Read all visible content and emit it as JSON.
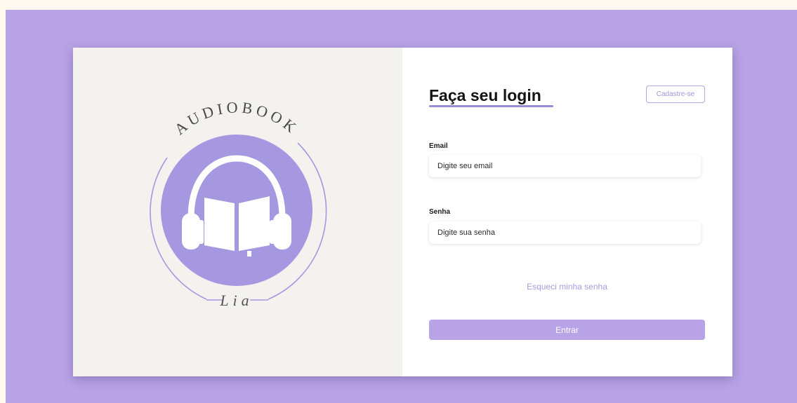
{
  "colors": {
    "background": "#b8a3e6",
    "accent": "#b7a3e5",
    "logo_circle": "#a698e0",
    "left_panel": "#f3f2ef",
    "link": "#ac9ce0"
  },
  "logo": {
    "top_text": "AUDIOBOOK",
    "bottom_text": "Lia",
    "icon": "headphones-book-icon"
  },
  "login": {
    "title": "Faça seu login",
    "signup_label": "Cadastre-se",
    "email_label": "Email",
    "email_placeholder": "Digite seu email",
    "password_label": "Senha",
    "password_placeholder": "Digite sua senha",
    "forgot_label": "Esqueci minha senha",
    "submit_label": "Entrar"
  }
}
